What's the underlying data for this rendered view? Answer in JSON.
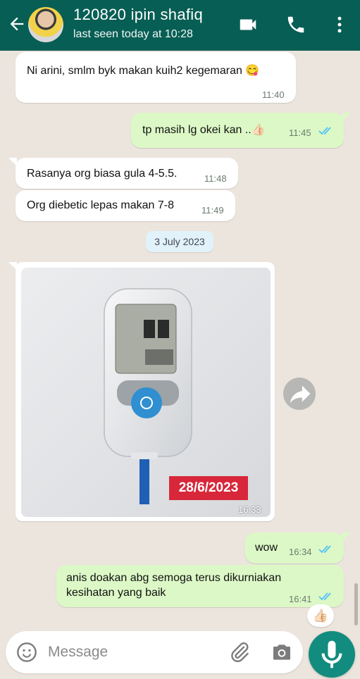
{
  "header": {
    "contact_name": "120820 ipin shafiq",
    "last_seen": "last seen today at 10:28"
  },
  "messages": [
    {
      "dir": "in",
      "text": "Ni arini, smlm byk makan kuih2 kegemaran 😋",
      "time": "11:40"
    },
    {
      "dir": "out",
      "text": "tp masih lg okei kan ..👍🏻",
      "time": "11:45",
      "read": true
    },
    {
      "dir": "in",
      "text": "Rasanya org biasa gula 4-5.5.",
      "time": "11:48"
    },
    {
      "dir": "in",
      "text": "Org diebetic lepas makan 7-8",
      "time": "11:49"
    },
    {
      "dir": "date",
      "text": "3 July 2023"
    },
    {
      "dir": "in",
      "type": "image",
      "overlay_text": "28/6/2023",
      "time": "16:33"
    },
    {
      "dir": "out",
      "text": "wow",
      "time": "16:34",
      "read": true
    },
    {
      "dir": "out",
      "text_line1": "anis doakan abg semoga terus dikurniakan",
      "text_line2": "kesihatan yang baik",
      "time": "16:41",
      "read": true,
      "reaction": "👍🏻"
    }
  ],
  "composer": {
    "placeholder": "Message"
  },
  "colors": {
    "header": "#075e54",
    "outgoing": "#dcf8c6",
    "incoming": "#ffffff",
    "read_ticks": "#4fc3f7",
    "mic": "#128c7e"
  },
  "icons": [
    "back-arrow-icon",
    "video-call-icon",
    "phone-icon",
    "more-vert-icon",
    "forward-icon",
    "emoji-icon",
    "paperclip-icon",
    "camera-icon",
    "mic-icon"
  ]
}
